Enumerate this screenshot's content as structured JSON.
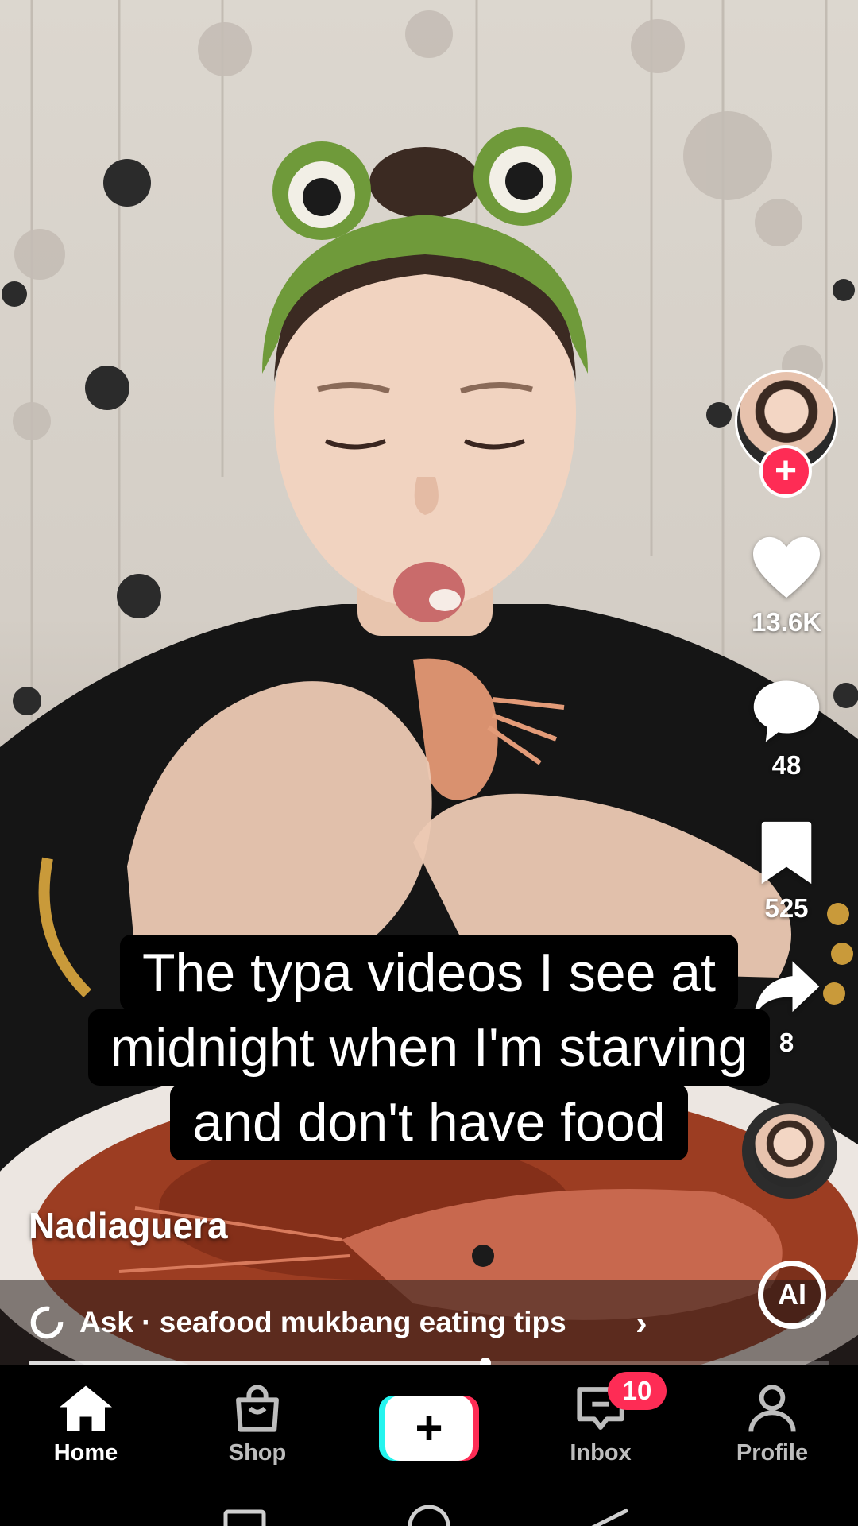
{
  "caption": {
    "lines": [
      "The typa videos I see at",
      "midnight when I'm starving",
      "and don't have food"
    ]
  },
  "author": "Nadiaguera",
  "actions": {
    "likes": "13.6K",
    "comments": "48",
    "saves": "525",
    "shares": "8"
  },
  "ask_bar": {
    "text": "Ask · seafood mukbang eating tips",
    "ai_label": "AI"
  },
  "progress": 0.57,
  "bottom_nav": {
    "home": "Home",
    "shop": "Shop",
    "create": "+",
    "inbox": "Inbox",
    "inbox_badge": "10",
    "profile": "Profile"
  },
  "colors": {
    "accent_red": "#fe2c55",
    "accent_cyan": "#25f4ee"
  },
  "icons": [
    "heart-icon",
    "comment-icon",
    "bookmark-icon",
    "share-icon",
    "home-icon",
    "shop-bag-icon",
    "inbox-icon",
    "profile-icon"
  ]
}
